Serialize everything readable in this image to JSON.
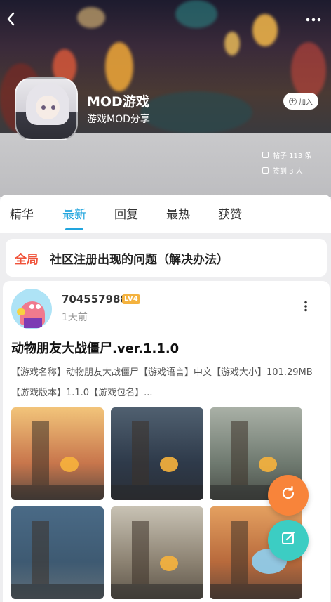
{
  "header": {
    "club_name": "MOD游戏",
    "club_desc": "游戏MOD分享",
    "join_label": "加入",
    "stats": [
      {
        "label": "帖子 113 条",
        "icon": "post-count-icon"
      },
      {
        "label": "签到 3 人",
        "icon": "checkin-icon"
      }
    ],
    "back_icon": "back-arrow-icon",
    "more_icon": "more-dots-icon"
  },
  "tabs": [
    {
      "label": "精华",
      "active": false
    },
    {
      "label": "最新",
      "active": true
    },
    {
      "label": "回复",
      "active": false
    },
    {
      "label": "最热",
      "active": false
    },
    {
      "label": "获赞",
      "active": false
    }
  ],
  "pinned": {
    "tag": "全局",
    "title": "社区注册出现的问题（解决办法）"
  },
  "post": {
    "username": "704557988",
    "level": "LV4",
    "time": "1天前",
    "title": "动物朋友大战僵尸.ver.1.1.0",
    "body": "【游戏名称】动物朋友大战僵尸【游戏语言】中文【游戏大小】101.29MB【游戏版本】1.1.0【游戏包名】...",
    "images": [
      "game-screenshot-1",
      "game-screenshot-2",
      "game-screenshot-3",
      "game-screenshot-4",
      "game-screenshot-5",
      "game-screenshot-6"
    ]
  },
  "fabs": {
    "refresh_icon": "refresh-icon",
    "compose_icon": "compose-icon"
  },
  "colors": {
    "accent": "#22a5de",
    "pinned_tag": "#f0533a",
    "level_badge": "#f4b23e",
    "fab_refresh": "#f8843a",
    "fab_compose": "#3ccdc3"
  }
}
